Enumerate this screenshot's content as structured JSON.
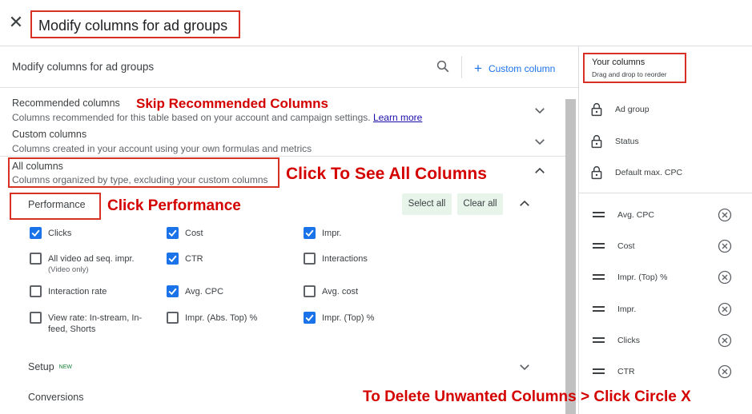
{
  "dialog": {
    "title": "Modify columns for ad groups"
  },
  "panel": {
    "title": "Modify columns for ad groups",
    "custom_column": "Custom column"
  },
  "sections": {
    "recommended": {
      "title": "Recommended columns",
      "subtitle": "Columns recommended for this table based on your account and campaign settings.",
      "link": "Learn more"
    },
    "custom": {
      "title": "Custom columns",
      "subtitle": "Columns created in your account using your own formulas and metrics"
    },
    "all": {
      "title": "All columns",
      "subtitle": "Columns organized by type, excluding your custom columns"
    }
  },
  "performance": {
    "title": "Performance",
    "select_all": "Select all",
    "clear_all": "Clear all",
    "checkboxes": [
      {
        "label": "Clicks",
        "checked": true
      },
      {
        "label": "Cost",
        "checked": true
      },
      {
        "label": "Impr.",
        "checked": true
      },
      {
        "label": "All video ad seq. impr.",
        "sub": "(Video only)",
        "checked": false
      },
      {
        "label": "CTR",
        "checked": true
      },
      {
        "label": "Interactions",
        "checked": false
      },
      {
        "label": "Interaction rate",
        "checked": false
      },
      {
        "label": "Avg. CPC",
        "checked": true
      },
      {
        "label": "Avg. cost",
        "checked": false
      },
      {
        "label": "View rate: In-stream, In-feed, Shorts",
        "checked": false
      },
      {
        "label": "Impr. (Abs. Top) %",
        "checked": false
      },
      {
        "label": "Impr. (Top) %",
        "checked": true
      }
    ]
  },
  "setup": {
    "title": "Setup",
    "badge": "NEW"
  },
  "conversions": {
    "title": "Conversions"
  },
  "your_columns": {
    "title": "Your columns",
    "subtitle": "Drag and drop to reorder",
    "locked": [
      "Ad group",
      "Status",
      "Default max. CPC"
    ],
    "items": [
      "Avg. CPC",
      "Cost",
      "Impr. (Top) %",
      "Impr.",
      "Clicks",
      "CTR"
    ]
  },
  "annotations": {
    "skip": "Skip Recommended Columns",
    "see_all": "Click To See All Columns",
    "performance": "Click Performance",
    "delete": "To Delete Unwanted Columns > Click Circle X"
  },
  "colors": {
    "annotation_red": "#d40000",
    "accent_blue": "#1a73e8",
    "button_green": "#e6f4ea"
  }
}
